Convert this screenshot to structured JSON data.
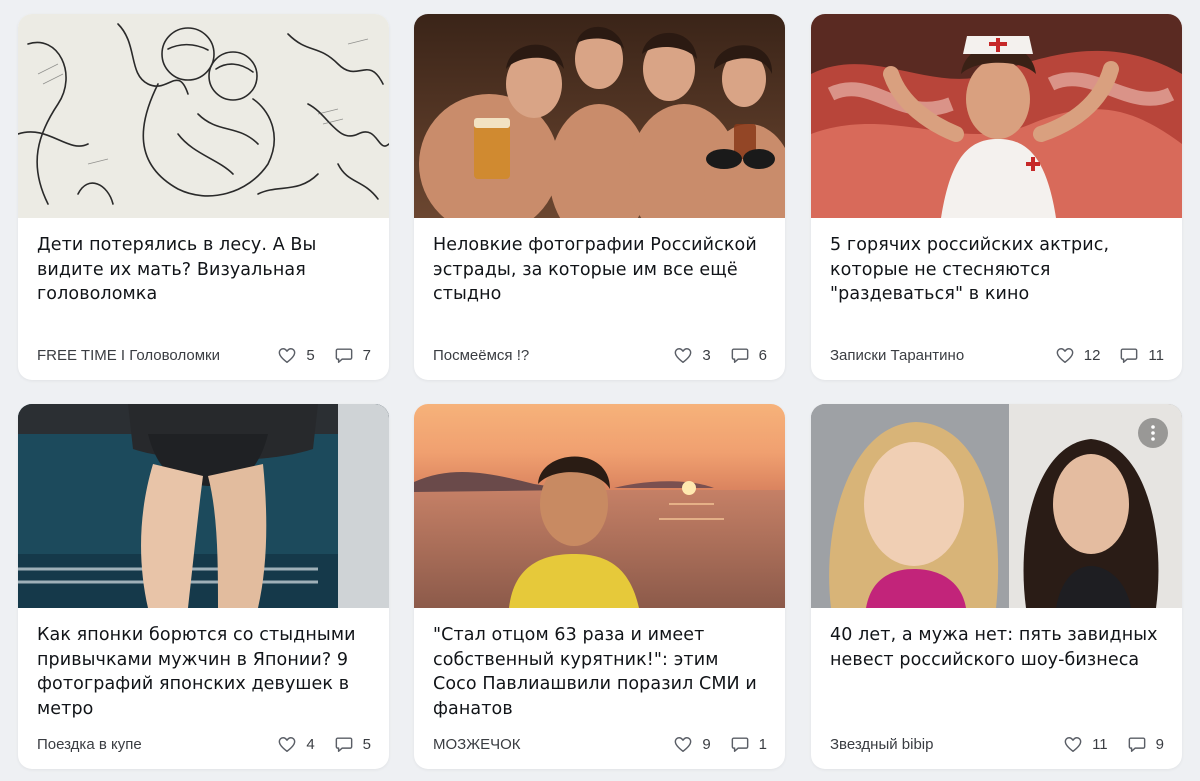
{
  "cards": [
    {
      "title": "Дети потерялись в лесу. А Вы видите их мать? Визуальная головоломка",
      "channel": "FREE TIME I Головоломки",
      "likes": "5",
      "comments": "7",
      "image": "pencil-sketch-children-in-forest"
    },
    {
      "title": "Неловкие фотографии Российской эстрады, за которые им все ещё стыдно",
      "channel": "Посмеёмся !?",
      "likes": "3",
      "comments": "6",
      "image": "group-of-people-with-beer"
    },
    {
      "title": "5 горячих российских актрис, которые не стесняются \"раздеваться\" в кино",
      "channel": "Записки Тарантино",
      "likes": "12",
      "comments": "11",
      "image": "actress-in-nurse-costume"
    },
    {
      "title": "Как японки борются со стыдными привычками мужчин в Японии? 9 фотографий японских девушек в метро",
      "channel": "Поездка в купе",
      "likes": "4",
      "comments": "5",
      "image": "legs-on-metro-seat"
    },
    {
      "title": "\"Стал отцом 63 раза и имеет собственный курятник!\": этим Сосо Павлиашвили поразил СМИ и фанатов",
      "channel": "МОЗЖЕЧОК",
      "likes": "9",
      "comments": "1",
      "image": "man-at-sunset-sea"
    },
    {
      "title": "40 лет, а мужа нет: пять завидных невест российского шоу-бизнеса",
      "channel": "Звездный bibip",
      "likes": "11",
      "comments": "9",
      "image": "two-women-portraits"
    }
  ],
  "icons": {
    "like": "heart-icon",
    "comment": "comment-icon",
    "more": "more-vertical-icon"
  }
}
